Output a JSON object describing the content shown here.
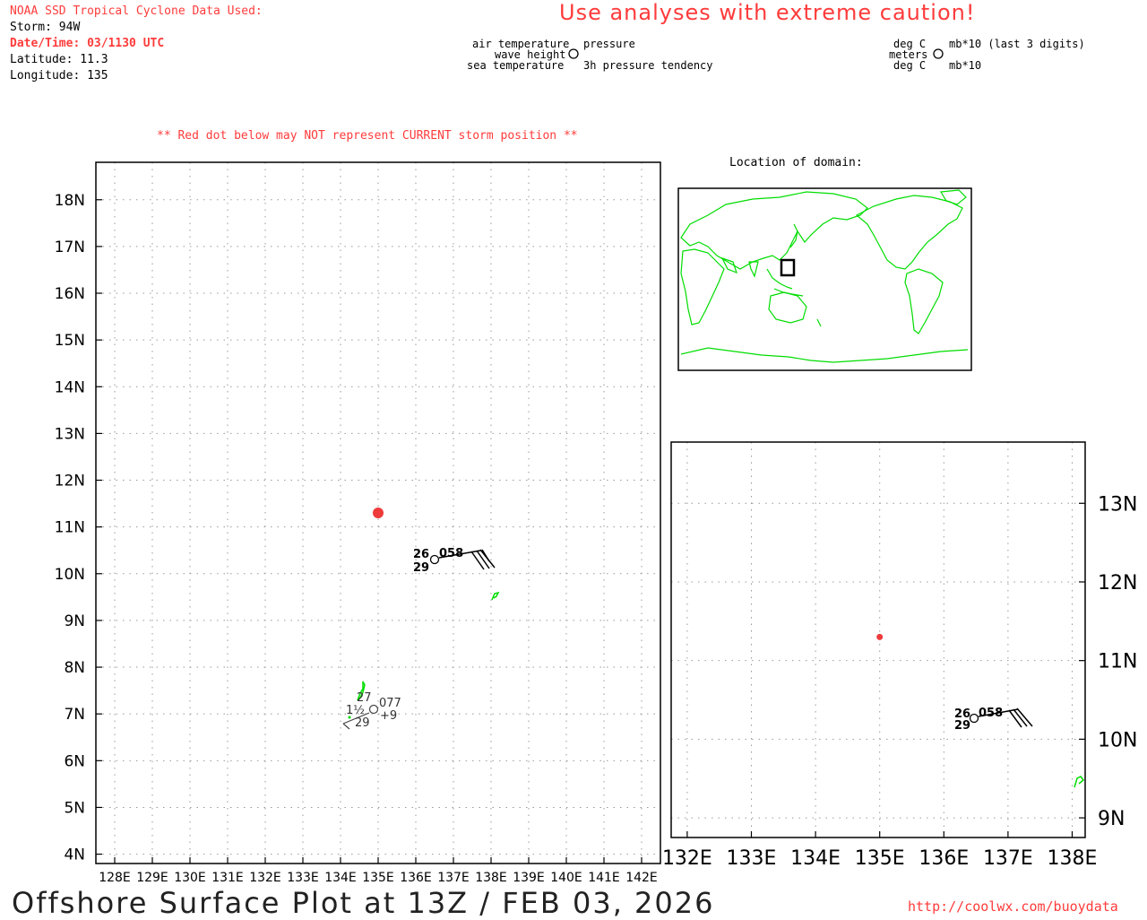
{
  "header": {
    "source_line": "NOAA SSD Tropical Cyclone Data Used:",
    "storm": "Storm: 94W",
    "datetime": "Date/Time: 03/1130 UTC",
    "latitude": "Latitude: 11.3",
    "longitude": "Longitude: 135",
    "caution": "Use analyses with extreme caution!",
    "red_dot_warning": "** Red dot below may NOT represent CURRENT storm position **",
    "inset_title": "Location of domain:"
  },
  "legend": {
    "air_temperature": "air temperature",
    "wave_height": "wave height",
    "sea_temperature": "sea temperature",
    "pressure": "pressure",
    "pressure_tendency": "3h pressure tendency",
    "unit_air": "deg C",
    "unit_wave": "meters",
    "unit_sea": "deg C",
    "unit_pressure": "mb*10 (last 3 digits)",
    "unit_tendency": "mb*10"
  },
  "main_map": {
    "lat_labels": [
      "4N",
      "5N",
      "6N",
      "7N",
      "8N",
      "9N",
      "10N",
      "11N",
      "12N",
      "13N",
      "14N",
      "15N",
      "16N",
      "17N",
      "18N"
    ],
    "lon_labels": [
      "128E",
      "129E",
      "130E",
      "131E",
      "132E",
      "133E",
      "134E",
      "135E",
      "136E",
      "137E",
      "138E",
      "139E",
      "140E",
      "141E",
      "142E"
    ],
    "storm_position": {
      "lat": 11.3,
      "lon": 135
    },
    "station1": {
      "air_temp": "26",
      "pressure": "058",
      "sea_temp": "29"
    },
    "station2": {
      "air_temp": "27",
      "pressure": "077",
      "wave_height": "1½",
      "tendency": "+9",
      "sea_temp": "29"
    }
  },
  "zoom_map": {
    "lat_labels": [
      "9N",
      "10N",
      "11N",
      "12N",
      "13N"
    ],
    "lon_labels": [
      "132E",
      "133E",
      "134E",
      "135E",
      "136E",
      "137E",
      "138E"
    ],
    "station1": {
      "air_temp": "26",
      "pressure": "058",
      "sea_temp": "29"
    }
  },
  "footer": {
    "title": "Offshore Surface Plot at 13Z / FEB 03, 2026",
    "url": "http://coolwx.com/buoydata"
  },
  "colors": {
    "accent_red": "#ff3b3b",
    "land_green": "#00dd00"
  }
}
